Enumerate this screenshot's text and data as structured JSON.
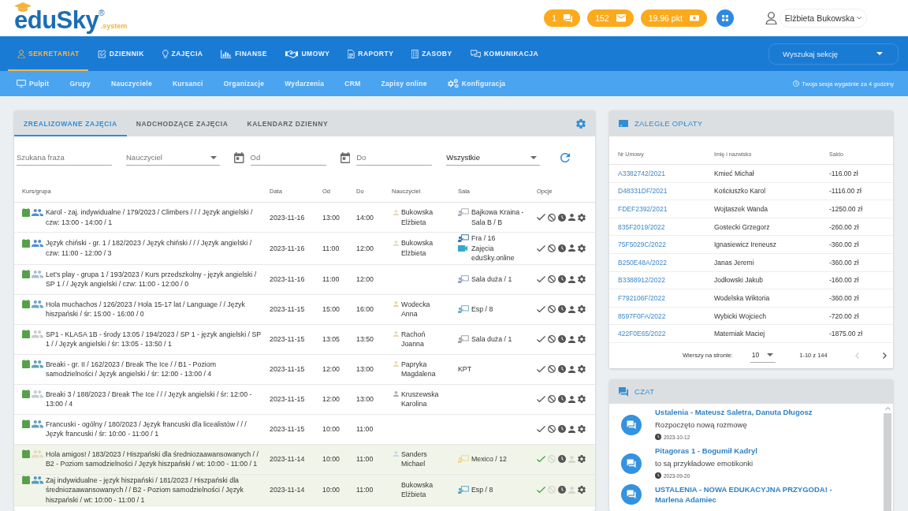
{
  "header": {
    "logo": {
      "text": "eduSky",
      "mark": "®",
      "suffix": ".system"
    },
    "badges": [
      {
        "kind": "chat",
        "label": "1"
      },
      {
        "kind": "mail",
        "label": "152"
      },
      {
        "kind": "points",
        "label": "19.96 pkt"
      }
    ],
    "user": {
      "name": "Elżbieta Bukowska"
    }
  },
  "nav": {
    "items": [
      {
        "label": "SEKRETARIAT",
        "selected": true
      },
      {
        "label": "DZIENNIK",
        "selected": false
      },
      {
        "label": "ZAJĘCIA",
        "selected": false
      },
      {
        "label": "FINANSE",
        "selected": false
      },
      {
        "label": "UMOWY",
        "selected": false
      },
      {
        "label": "RAPORTY",
        "selected": false
      },
      {
        "label": "ZASOBY",
        "selected": false
      },
      {
        "label": "KOMUNIKACJA",
        "selected": false
      }
    ],
    "search": {
      "placeholder": "Wyszukaj sekcję"
    }
  },
  "subnav": {
    "items": [
      {
        "label": "Pulpit"
      },
      {
        "label": "Grupy"
      },
      {
        "label": "Nauczyciele"
      },
      {
        "label": "Kursanci"
      },
      {
        "label": "Organizacje"
      },
      {
        "label": "Wydarzenia"
      },
      {
        "label": "CRM"
      },
      {
        "label": "Zapisy online"
      },
      {
        "label": "Konfiguracja"
      }
    ],
    "session_note": "Twoja sesja wygaśnie za 4 godziny"
  },
  "lessons": {
    "tabs": [
      {
        "label": "ZREALIZOWANE ZAJĘCIA",
        "selected": true
      },
      {
        "label": "NADCHODZĄCE ZAJĘCIA",
        "selected": false
      },
      {
        "label": "KALENDARZ DZIENNY",
        "selected": false
      }
    ],
    "filters": [
      {
        "kind": "text",
        "placeholder": "Szukana fraza"
      },
      {
        "kind": "select",
        "placeholder": "Nauczyciel"
      },
      {
        "kind": "date",
        "placeholder": "Od"
      },
      {
        "kind": "date",
        "placeholder": "Do"
      },
      {
        "kind": "select",
        "value": "Wszystkie"
      }
    ],
    "table": {
      "columns": [
        "Kurs/grupa",
        "Data",
        "Od",
        "Do",
        "Nauczyciel",
        "Sala",
        "Opcje"
      ],
      "rows": [
        {
          "group_icon": {
            "color": "#4a90d9"
          },
          "course": "Karol - zaj. indywidualne / 179/2023 / Climbers / / / Język angielski / czw: 13:00 - 14:00 / 1",
          "date": "2023-11-16",
          "from": "13:00",
          "to": "14:00",
          "teacher": {
            "name": "Bukowska Elżbieta",
            "color": "#e6dbc0"
          },
          "rooms": [
            {
              "kind": "room",
              "label": "Bajkowa Kraina - Sala B / B",
              "color": "#a9b1b8"
            }
          ],
          "completed": false
        },
        {
          "group_icon": {
            "color": "#4a90d9"
          },
          "course": "Język chiński - gr. 1 / 182/2023 / Język chiński / / / Język angielski / czw: 11:00 - 12:00 / 3",
          "date": "2023-11-16",
          "from": "11:00",
          "to": "12:00",
          "teacher": {
            "name": "Bukowska Elżbieta",
            "color": "#e6dbc0"
          },
          "rooms": [
            {
              "kind": "room",
              "label": "Fra / 16",
              "color": "#3b78a8"
            },
            {
              "kind": "online",
              "label": "Zajęcia eduSky.online",
              "color": "#3aa6c9"
            }
          ],
          "completed": false
        },
        {
          "group_icon": {
            "color": "#a9bdd3"
          },
          "course": "Let's play - grupa 1 / 193/2023 / Kurs przedszkolny - język angielski / SP 1 / / Język angielski / czw: 11:00 - 12:00 / 0",
          "date": "2023-11-16",
          "from": "11:00",
          "to": "12:00",
          "rooms": [
            {
              "kind": "room",
              "label": "Sala duża / 1",
              "color": "#9aa3c9"
            }
          ],
          "completed": false
        },
        {
          "group_icon": {
            "color": "#6aa6c4"
          },
          "course": "Hola muchachos / 126/2023 / Hola 15-17 lat / Language / / Język hiszpański / śr: 15:00 - 16:00 / 0",
          "date": "2023-11-15",
          "from": "15:00",
          "to": "16:00",
          "teacher": {
            "name": "Wodecka Anna",
            "color": "#e6d3a0"
          },
          "rooms": [
            {
              "kind": "room",
              "label": "Esp / 8",
              "color": "#6fb0c7"
            }
          ],
          "completed": false
        },
        {
          "group_icon": {
            "color": "#c7cbd0"
          },
          "course": "SP1 - KLASA 1B - środy 13:05 / 194/2023 / SP 1 - język angielski / SP 1 / / Język angielski / śr: 13:05 - 13:50 / 1",
          "date": "2023-11-15",
          "from": "13:05",
          "to": "13:50",
          "teacher": {
            "name": "Rachoń Joanna",
            "color": "#e8d8ab"
          },
          "rooms": [
            {
              "kind": "room",
              "label": "Sala duża / 1",
              "color": "#9ea4aa"
            }
          ],
          "completed": false
        },
        {
          "group_icon": {
            "color": "#5fa3b8"
          },
          "course": "Breaki - gr. II / 162/2023 / Break The Ice / / B1 - Poziom samodzielności / Język angielski / śr: 12:00 - 13:00 / 4",
          "date": "2023-11-15",
          "from": "12:00",
          "to": "13:00",
          "teacher": {
            "name": "Papryka Magdalena",
            "color": "#e8d8ab"
          },
          "rooms": [
            {
              "kind": "text",
              "label": "KPT"
            }
          ],
          "completed": false
        },
        {
          "group_icon": {
            "color": "#c6cbd0"
          },
          "course": "Breaki 3 / 188/2023 / Break The Ice / / / Język angielski / śr: 12:00 - 13:00 / 4",
          "date": "2023-11-15",
          "from": "12:00",
          "to": "13:00",
          "teacher": {
            "name": "Kruszewska Karolina",
            "color": "#a8adb2"
          },
          "completed": false
        },
        {
          "group_icon": {
            "color": "#62a3ba"
          },
          "course": "Francuski - ogólny / 180/2023 / Język francuski dla licealistów / / / Język francuski / śr: 10:00 - 11:00 / 1",
          "date": "2023-11-15",
          "from": "10:00",
          "to": "11:00",
          "completed": false
        },
        {
          "group_icon": {
            "color": "#e6dbbf"
          },
          "course": "Hola amigos! / 183/2023 / Hiszpański dla średniozaawansowanych / / B2 - Poziom samodzielności / Język hiszpański / wt: 10:00 - 11:00 / 1",
          "date": "2023-11-14",
          "from": "10:00",
          "to": "11:00",
          "teacher": {
            "name": "Sanders Michael",
            "color": "#c7d6e6"
          },
          "rooms": [
            {
              "kind": "room",
              "label": "Mexico / 12",
              "color": "#f0d98e"
            }
          ],
          "completed": true
        },
        {
          "group_icon": {
            "color": "#4f9cbf"
          },
          "course": "Zaj indywidualne - język hiszpański / 181/2023 / Hiszpański dla średniozaawansowanych / / B2 - Poziom samodzielności / Język hiszpański / wt: 10:00 - 11:00 / 1",
          "date": "2023-11-14",
          "from": "10:00",
          "to": "11:00",
          "teacher": {
            "name": "Bukowska Elżbieta"
          },
          "rooms": [
            {
              "kind": "room",
              "label": "Esp / 8",
              "color": "#5aa8c8"
            }
          ],
          "completed": true
        }
      ]
    }
  },
  "arrears": {
    "title": "ZALEGŁE OPŁATY",
    "columns": [
      "Nr Umowy",
      "Imię i nazwisko",
      "Saldo"
    ],
    "rows": [
      {
        "contract": "A3382742/2021",
        "name": "Kmieć Michał",
        "balance": "-116.00 zł"
      },
      {
        "contract": "D48331DF/2021",
        "name": "Kościuszko Karol",
        "balance": "-1116.00 zł"
      },
      {
        "contract": "FDEF2392/2021",
        "name": "Wojtaszek Wanda",
        "balance": "-1250.00 zł"
      },
      {
        "contract": "835F2019/2022",
        "name": "Gostecki Grzegorz",
        "balance": "-260.00 zł"
      },
      {
        "contract": "75F5029C/2022",
        "name": "Ignasiewicz Ireneusz",
        "balance": "-360.00 zł"
      },
      {
        "contract": "B250E48A/2022",
        "name": "Janas Jeremi",
        "balance": "-360.00 zł"
      },
      {
        "contract": "B3388912/2022",
        "name": "Jodłowski Jakub",
        "balance": "-160.00 zł"
      },
      {
        "contract": "F792106F/2022",
        "name": "Wodelska Wiktoria",
        "balance": "-360.00 zł"
      },
      {
        "contract": "8597F0FA/2022",
        "name": "Wybicki Wojciech",
        "balance": "-720.00 zł"
      },
      {
        "contract": "422F0E65/2022",
        "name": "Materniak Maciej",
        "balance": "-1875.00 zł"
      }
    ],
    "pagination": {
      "label": "Wierszy na stronie:",
      "per_page": "10",
      "range": "1-10 z 144",
      "prev": {
        "disabled": true
      },
      "next": {
        "disabled": false
      }
    }
  },
  "chat": {
    "title": "CZAT",
    "items": [
      {
        "title": "Ustalenia - Mateusz Saletra, Danuta Długosz",
        "message": "Rozpoczęto nową rozmowę",
        "date": "2023-10-12"
      },
      {
        "title": "Pitagoras 1 - Bogumił Kadryl",
        "message": "to są przykładowe emotikonki",
        "date": "2023-09-20"
      },
      {
        "title": "USTALENIA - NOWA EDUKACYJNA PRZYGODA! - Marlena Adamiec"
      }
    ]
  }
}
